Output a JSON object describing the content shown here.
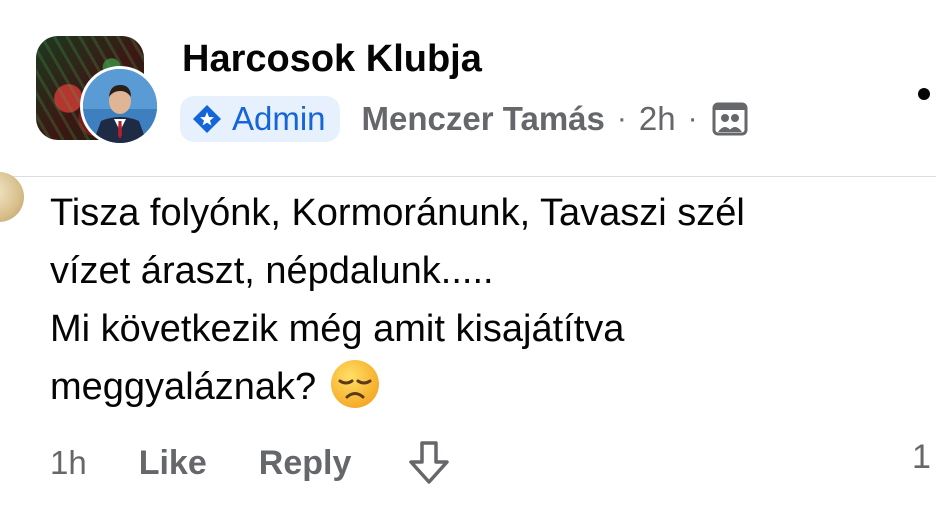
{
  "post": {
    "group_name": "Harcosok Klubja",
    "admin_label": "Admin",
    "author": "Menczer Tamás",
    "separator": "·",
    "time": "2h",
    "icons": {
      "admin_badge": "admin-badge-icon",
      "audience": "group-audience-icon",
      "more": "more-options-icon"
    },
    "colors": {
      "admin": "#1466d8",
      "admin_bg": "#e7f0fd",
      "meta": "#65676b"
    }
  },
  "comment": {
    "lines": [
      "Tisza folyónk, Kormoránunk, Tavaszi szél",
      "vízet áraszt, népdalunk.....",
      "Mi következik még amit kisajátítva",
      "meggyaláznak?"
    ],
    "emoji": "disappointed-face-emoji",
    "time": "1h",
    "like_label": "Like",
    "reply_label": "Reply",
    "downvote_icon": "downvote-arrow-icon",
    "reaction_count": "1"
  }
}
